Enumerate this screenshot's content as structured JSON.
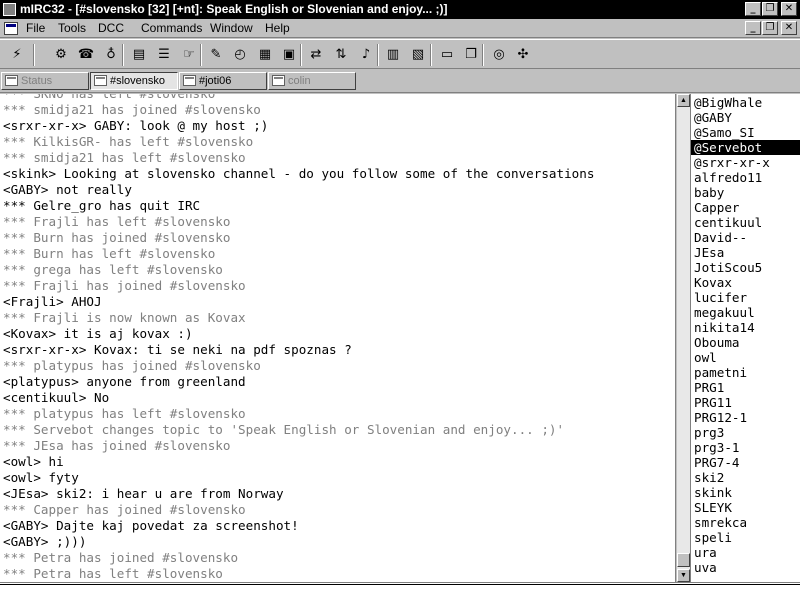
{
  "window": {
    "title": "mIRC32 - [#slovensko [32] [+nt]: Speak English or Slovenian and enjoy... ;)]"
  },
  "menu": {
    "items": [
      "File",
      "Tools",
      "DCC",
      "Commands",
      "Window",
      "Help"
    ]
  },
  "toolbar": {
    "icons": [
      "connect-icon",
      "options-icon",
      "address-book-icon",
      "server-icon",
      "channels-folder-icon",
      "channel-list-icon",
      "finger-icon",
      "scripts-icon",
      "timer-icon",
      "colors-icon",
      "dcc-send-icon",
      "dcc-chat-icon",
      "dcc-options-icon",
      "notify-icon",
      "list-icon",
      "tile-horizontal-icon",
      "cascade-icon",
      "help-icon",
      "about-icon"
    ]
  },
  "switchbar": {
    "tabs": [
      {
        "label": "Status",
        "active": false
      },
      {
        "label": "#slovensko",
        "active": true
      },
      {
        "label": "#joti06",
        "active": false
      },
      {
        "label": "colin",
        "active": false
      }
    ]
  },
  "chat": {
    "lines": [
      {
        "text": "*** SKNO has left #slovensko",
        "type": "event"
      },
      {
        "text": "*** smidja21 has joined #slovensko",
        "type": "event"
      },
      {
        "text": "<srxr-xr-x> GABY: look @ my host ;)",
        "type": "msg"
      },
      {
        "text": "*** KilkisGR- has left #slovensko",
        "type": "event"
      },
      {
        "text": "*** smidja21 has left #slovensko",
        "type": "event"
      },
      {
        "text": "<skink> Looking at slovensko channel - do you follow some of the conversations",
        "type": "msg"
      },
      {
        "text": "<GABY> not really",
        "type": "msg"
      },
      {
        "text": "*** Gelre_gro has quit IRC",
        "type": "msg"
      },
      {
        "text": "*** Frajli has left #slovensko",
        "type": "event"
      },
      {
        "text": "*** Burn has joined #slovensko",
        "type": "event"
      },
      {
        "text": "*** Burn has left #slovensko",
        "type": "event"
      },
      {
        "text": "*** grega has left #slovensko",
        "type": "event"
      },
      {
        "text": "*** Frajli has joined #slovensko",
        "type": "event"
      },
      {
        "text": "<Frajli> AHOJ",
        "type": "msg"
      },
      {
        "text": "*** Frajli is now known as Kovax",
        "type": "event"
      },
      {
        "text": "<Kovax> it is aj kovax :)",
        "type": "msg"
      },
      {
        "text": "<srxr-xr-x> Kovax: ti se neki na pdf spoznas ?",
        "type": "msg"
      },
      {
        "text": "*** platypus has joined #slovensko",
        "type": "event"
      },
      {
        "text": "<platypus> anyone from greenland",
        "type": "msg"
      },
      {
        "text": "<centikuul> No",
        "type": "msg"
      },
      {
        "text": "*** platypus has left #slovensko",
        "type": "event"
      },
      {
        "text": "*** Servebot changes topic to 'Speak English or Slovenian and enjoy... ;)'",
        "type": "event"
      },
      {
        "text": "*** JEsa has joined #slovensko",
        "type": "event"
      },
      {
        "text": "<owl> hi",
        "type": "msg"
      },
      {
        "text": "<owl> fyty",
        "type": "msg"
      },
      {
        "text": "<JEsa> ski2: i hear u are from Norway",
        "type": "msg"
      },
      {
        "text": "*** Capper has joined #slovensko",
        "type": "event"
      },
      {
        "text": "<GABY> Dajte kaj povedat za screenshot!",
        "type": "msg"
      },
      {
        "text": "<GABY> ;)))",
        "type": "msg"
      },
      {
        "text": "*** Petra has joined #slovensko",
        "type": "event"
      },
      {
        "text": "*** Petra has left #slovensko",
        "type": "event"
      }
    ]
  },
  "nicklist": {
    "selected": "@Servebot",
    "nicks": [
      "@BigWhale",
      "@GABY",
      "@Samo_SI",
      "@Servebot",
      "@srxr-xr-x",
      "alfredo11",
      "baby",
      "Capper",
      "centikuul",
      "David--",
      "JEsa",
      "JotiScou5",
      "Kovax",
      "lucifer",
      "megakuul",
      "nikita14",
      "Obouma",
      "owl",
      "pametni",
      "PRG1",
      "PRG11",
      "PRG12-1",
      "prg3",
      "prg3-1",
      "PRG7-4",
      "ski2",
      "skink",
      "SLEYK",
      "smrekca",
      "speli",
      "ura",
      "uva"
    ]
  },
  "input": {
    "value": ""
  }
}
